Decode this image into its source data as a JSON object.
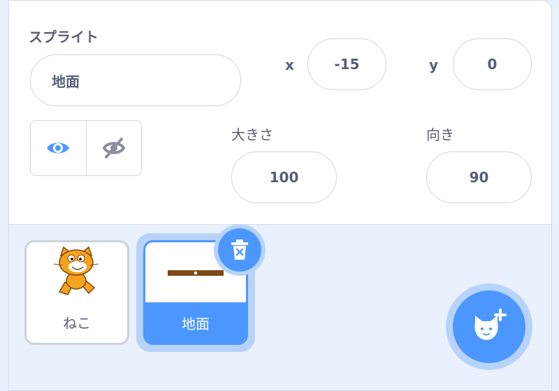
{
  "sprite_info": {
    "sprite_label": "スプライト",
    "sprite_name": "地面",
    "x_label": "x",
    "x_value": "-15",
    "y_label": "y",
    "y_value": "0",
    "size_label": "大きさ",
    "size_value": "100",
    "direction_label": "向き",
    "direction_value": "90",
    "show_icon": "eye-icon",
    "hide_icon": "eye-slash-icon"
  },
  "sprites": [
    {
      "name": "ねこ",
      "thumbnail": "cat-costume"
    },
    {
      "name": "地面",
      "thumbnail": "ground-costume",
      "selected": true
    }
  ],
  "actions": {
    "delete_icon": "trash-icon",
    "add_icon": "choose-sprite-icon"
  },
  "colors": {
    "accent": "#4c97ff",
    "accent_light": "#b8d3fb",
    "text": "#575e75",
    "pane_bg": "#e9f1fc"
  }
}
